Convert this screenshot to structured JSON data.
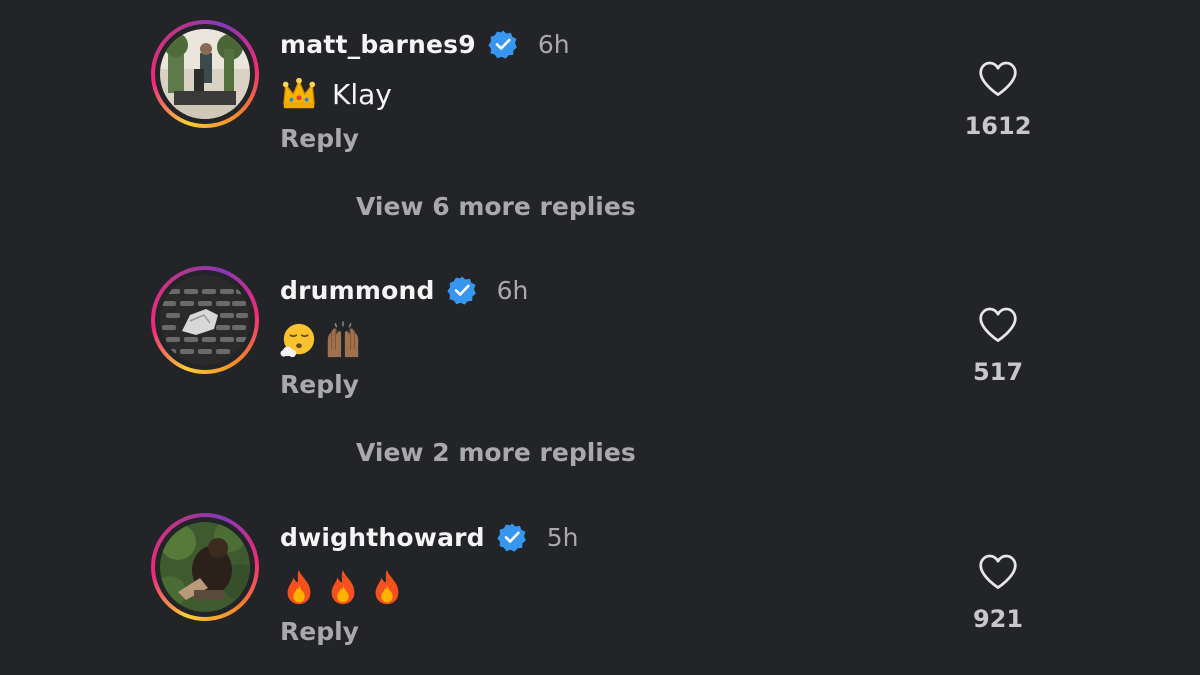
{
  "comments": [
    {
      "username": "matt_barnes9",
      "verified": true,
      "time": "6h",
      "text": "Klay",
      "emojis": [
        "crown"
      ],
      "reply_label": "Reply",
      "likes": "1612",
      "view_more": "View 6 more replies"
    },
    {
      "username": "drummond",
      "verified": true,
      "time": "6h",
      "text": "",
      "emojis": [
        "face-exhaling",
        "raising-hands"
      ],
      "reply_label": "Reply",
      "likes": "517",
      "view_more": "View 2 more replies"
    },
    {
      "username": "dwighthoward",
      "verified": true,
      "time": "5h",
      "text": "",
      "emojis": [
        "fire",
        "fire",
        "fire"
      ],
      "reply_label": "Reply",
      "likes": "921"
    }
  ],
  "colors": {
    "background": "#232428",
    "verified_badge": "#3797f0",
    "secondary_text": "#a8a8ad"
  },
  "icons": {
    "like": "heart-outline-icon",
    "verified": "verified-badge-icon"
  }
}
